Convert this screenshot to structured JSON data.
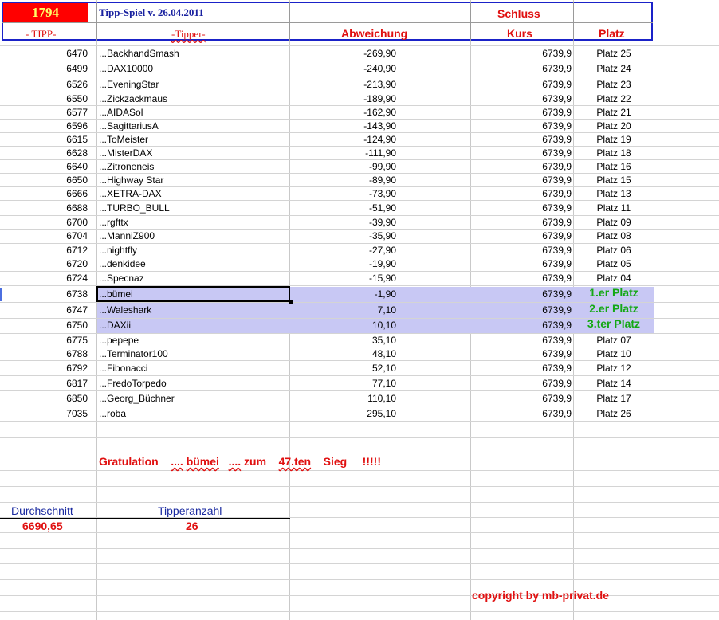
{
  "header": {
    "count": "1794",
    "title": "Tipp-Spiel v. 26.04.2011",
    "schluss": "Schluss",
    "col_tipp": "- TIPP-",
    "col_tipper": "-Tipper-",
    "col_abweichung": "Abweichung",
    "col_kurs": "Kurs",
    "col_platz": "Platz"
  },
  "rows": [
    {
      "tipp": "6470",
      "tipper": "...BackhandSmash",
      "abw": "-269,90",
      "kurs": "6739,9",
      "platz": "Platz 25"
    },
    {
      "tipp": "6499",
      "tipper": "...DAX10000",
      "abw": "-240,90",
      "kurs": "6739,9",
      "platz": "Platz 24"
    },
    {
      "tipp": "6526",
      "tipper": "...EveningStar",
      "abw": "-213,90",
      "kurs": "6739,9",
      "platz": "Platz 23"
    },
    {
      "tipp": "6550",
      "tipper": "...Zickzackmaus",
      "abw": "-189,90",
      "kurs": "6739,9",
      "platz": "Platz 22"
    },
    {
      "tipp": "6577",
      "tipper": "...AIDASol",
      "abw": "-162,90",
      "kurs": "6739,9",
      "platz": "Platz 21"
    },
    {
      "tipp": "6596",
      "tipper": "...SagittariusA",
      "abw": "-143,90",
      "kurs": "6739,9",
      "platz": "Platz 20"
    },
    {
      "tipp": "6615",
      "tipper": "...ToMeister",
      "abw": "-124,90",
      "kurs": "6739,9",
      "platz": "Platz 19"
    },
    {
      "tipp": "6628",
      "tipper": "...MisterDAX",
      "abw": "-111,90",
      "kurs": "6739,9",
      "platz": "Platz 18"
    },
    {
      "tipp": "6640",
      "tipper": "...Zitroneneis",
      "abw": "-99,90",
      "kurs": "6739,9",
      "platz": "Platz 16"
    },
    {
      "tipp": "6650",
      "tipper": "...Highway Star",
      "abw": "-89,90",
      "kurs": "6739,9",
      "platz": "Platz 15"
    },
    {
      "tipp": "6666",
      "tipper": "...XETRA-DAX",
      "abw": "-73,90",
      "kurs": "6739,9",
      "platz": "Platz 13"
    },
    {
      "tipp": "6688",
      "tipper": "...TURBO_BULL",
      "abw": "-51,90",
      "kurs": "6739,9",
      "platz": "Platz 11"
    },
    {
      "tipp": "6700",
      "tipper": "...rgfttx",
      "abw": "-39,90",
      "kurs": "6739,9",
      "platz": "Platz 09"
    },
    {
      "tipp": "6704",
      "tipper": "...ManniZ900",
      "abw": "-35,90",
      "kurs": "6739,9",
      "platz": "Platz 08"
    },
    {
      "tipp": "6712",
      "tipper": "...nightfly",
      "abw": "-27,90",
      "kurs": "6739,9",
      "platz": "Platz 06"
    },
    {
      "tipp": "6720",
      "tipper": "...denkidee",
      "abw": "-19,90",
      "kurs": "6739,9",
      "platz": "Platz 05"
    },
    {
      "tipp": "6724",
      "tipper": "...Specnaz",
      "abw": "-15,90",
      "kurs": "6739,9",
      "platz": "Platz 04"
    },
    {
      "tipp": "6738",
      "tipper": "...bümei",
      "abw": "-1,90",
      "kurs": "6739,9",
      "platz": "1.er Platz"
    },
    {
      "tipp": "6747",
      "tipper": "...Waleshark",
      "abw": "7,10",
      "kurs": "6739,9",
      "platz": "2.er Platz"
    },
    {
      "tipp": "6750",
      "tipper": "...DAXii",
      "abw": "10,10",
      "kurs": "6739,9",
      "platz": "3.ter Platz"
    },
    {
      "tipp": "6775",
      "tipper": "...pepepe",
      "abw": "35,10",
      "kurs": "6739,9",
      "platz": "Platz 07"
    },
    {
      "tipp": "6788",
      "tipper": "...Terminator100",
      "abw": "48,10",
      "kurs": "6739,9",
      "platz": "Platz 10"
    },
    {
      "tipp": "6792",
      "tipper": "...Fibonacci",
      "abw": "52,10",
      "kurs": "6739,9",
      "platz": "Platz 12"
    },
    {
      "tipp": "6817",
      "tipper": "...FredoTorpedo",
      "abw": "77,10",
      "kurs": "6739,9",
      "platz": "Platz 14"
    },
    {
      "tipp": "6850",
      "tipper": "...Georg_Büchner",
      "abw": "110,10",
      "kurs": "6739,9",
      "platz": "Platz 17"
    },
    {
      "tipp": "7035",
      "tipper": "...roba",
      "abw": "295,10",
      "kurs": "6739,9",
      "platz": "Platz 26"
    }
  ],
  "congrats": {
    "w1": "Gratulation",
    "w2": "....",
    "w3": "bümei",
    "w4": "....",
    "w5": "zum",
    "w6": "47.ten",
    "w7": "Sieg",
    "w8": "!!!!!"
  },
  "summary": {
    "avg_label": "Durchschnitt",
    "avg_value": "6690,65",
    "count_label": "Tipperanzahl",
    "count_value": "26"
  },
  "footer": {
    "copyright": "copyright by mb-privat.de"
  },
  "colors": {
    "header_border": "#1a22c8",
    "highlight_row": "#c8c8f4",
    "red_text": "#e01010",
    "green_place": "#14a814",
    "count_bg": "#ff0000"
  }
}
